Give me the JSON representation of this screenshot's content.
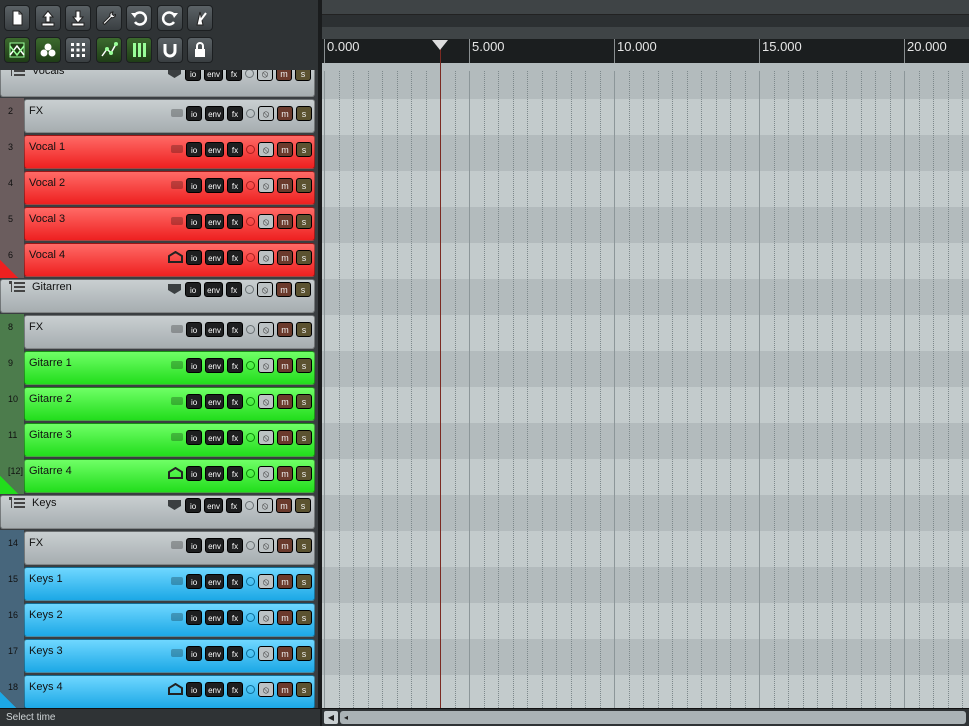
{
  "toolbar": {
    "row1": [
      "new-project-icon",
      "open-project-icon",
      "save-project-icon",
      "preferences-wrench-icon",
      "undo-icon",
      "redo-icon",
      "metronome-icon"
    ],
    "row2": [
      "auto-crossfade-icon",
      "ripple-edit-icon",
      "grid-snap-icon",
      "envelope-points-icon",
      "item-grouping-icon",
      "loop-points-icon",
      "lock-icon"
    ]
  },
  "colors": {
    "folder": "#b7bdbf",
    "red": "#ff3a3a",
    "green": "#33ee2d",
    "blue": "#2fbaf0",
    "arrange_dark": "#b3bbbd",
    "arrange_light": "#c3cbcc"
  },
  "tracks": [
    {
      "num": "",
      "name": "Vocals",
      "type": "folder",
      "color": "folder"
    },
    {
      "num": "2",
      "name": "FX",
      "type": "child",
      "color": "folder"
    },
    {
      "num": "3",
      "name": "Vocal 1",
      "type": "child",
      "color": "red"
    },
    {
      "num": "4",
      "name": "Vocal 2",
      "type": "child",
      "color": "red"
    },
    {
      "num": "5",
      "name": "Vocal 3",
      "type": "child",
      "color": "red"
    },
    {
      "num": "6",
      "name": "Vocal 4",
      "type": "last",
      "color": "red"
    },
    {
      "num": "",
      "name": "Gitarren",
      "type": "folder",
      "color": "folder"
    },
    {
      "num": "8",
      "name": "FX",
      "type": "child",
      "color": "folder"
    },
    {
      "num": "9",
      "name": "Gitarre 1",
      "type": "child",
      "color": "green"
    },
    {
      "num": "10",
      "name": "Gitarre 2",
      "type": "child",
      "color": "green"
    },
    {
      "num": "11",
      "name": "Gitarre 3",
      "type": "child",
      "color": "green"
    },
    {
      "num": "[12]",
      "name": "Gitarre 4",
      "type": "last",
      "color": "green"
    },
    {
      "num": "",
      "name": "Keys",
      "type": "folder",
      "color": "folder"
    },
    {
      "num": "14",
      "name": "FX",
      "type": "child",
      "color": "folder"
    },
    {
      "num": "15",
      "name": "Keys 1",
      "type": "child",
      "color": "blue"
    },
    {
      "num": "16",
      "name": "Keys 2",
      "type": "child",
      "color": "blue"
    },
    {
      "num": "17",
      "name": "Keys 3",
      "type": "child",
      "color": "blue"
    },
    {
      "num": "18",
      "name": "Keys 4",
      "type": "last",
      "color": "blue"
    }
  ],
  "track_buttons": {
    "io": "io",
    "env": "env",
    "fx": "fx",
    "mute": "m",
    "solo": "s"
  },
  "ruler": {
    "labels": [
      "0.000",
      "5.000",
      "10.000",
      "15.000",
      "20.000"
    ],
    "seconds_visible": 22.3,
    "cursor_seconds": 4.0
  },
  "status": {
    "text": "Select time"
  }
}
